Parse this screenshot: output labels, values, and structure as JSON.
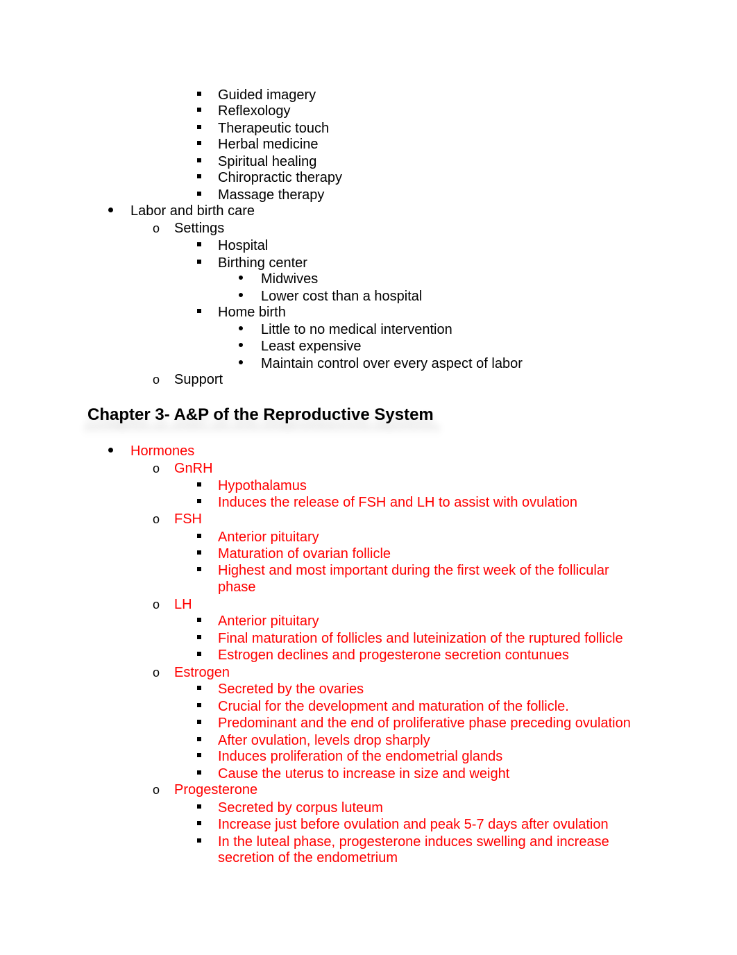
{
  "section1": {
    "l3_items_top": [
      "Guided imagery",
      "Reflexology",
      "Therapeutic touch",
      "Herbal medicine",
      "Spiritual healing",
      "Chiropractic therapy",
      "Massage therapy"
    ],
    "labor": {
      "label": "Labor and birth care",
      "settings": {
        "label": "Settings",
        "hospital": "Hospital",
        "birthing_center": {
          "label": "Birthing center",
          "items": [
            "Midwives",
            "Lower cost than a hospital"
          ]
        },
        "home_birth": {
          "label": "Home birth",
          "items": [
            "Little to no medical intervention",
            "Least expensive",
            "Maintain control over every aspect of labor"
          ]
        }
      },
      "support": "Support"
    }
  },
  "chapter3": {
    "title": "Chapter 3- A&P of the Reproductive System",
    "accent_color": "#ff0000",
    "hormones": {
      "label": "Hormones",
      "gnrh": {
        "label": "GnRH",
        "items": [
          "Hypothalamus",
          "Induces the release of FSH and LH to assist with ovulation"
        ]
      },
      "fsh": {
        "label": "FSH",
        "items": [
          "Anterior pituitary",
          "Maturation of ovarian follicle",
          "Highest and most important during the first week of the follicular",
          "phase"
        ]
      },
      "lh": {
        "label": "LH",
        "items": [
          "Anterior pituitary",
          "Final maturation of follicles and luteinization of the ruptured follicle",
          "Estrogen declines and progesterone secretion contunues"
        ]
      },
      "estrogen": {
        "label": "Estrogen",
        "items": [
          "Secreted by the ovaries",
          "Crucial for the development and maturation of the follicle.",
          "Predominant and the end of proliferative phase preceding ovulation",
          "After ovulation, levels drop sharply",
          "Induces proliferation of the endometrial glands",
          "Cause the uterus to increase in size and weight"
        ]
      },
      "progesterone": {
        "label": "Progesterone",
        "items": [
          "Secreted by corpus luteum",
          "Increase just before ovulation and peak 5-7 days after ovulation",
          "In the luteal phase, progesterone induces swelling and increase",
          "secretion of the endometrium"
        ]
      }
    }
  },
  "markers": {
    "level1": "•",
    "level2": "o"
  }
}
